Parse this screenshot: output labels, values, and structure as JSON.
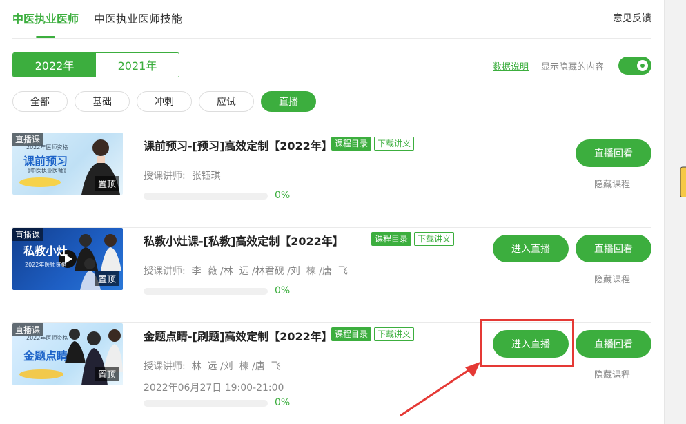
{
  "top_tabs": [
    "中医执业医师",
    "中医执业医师技能"
  ],
  "feedback": "意见反馈",
  "years": [
    "2022年",
    "2021年"
  ],
  "data_note": "数据说明",
  "show_hidden": "显示隐藏的内容",
  "show_hidden_on": true,
  "filters": [
    "全部",
    "基础",
    "冲刺",
    "应试",
    "直播"
  ],
  "active_filter": "直播",
  "courses": [
    {
      "title": "课前预习-[预习]高效定制【2022年】",
      "thumb_tag": "直播课",
      "thumb_pin": "置顶",
      "thumb_title": "课前预习",
      "thumb_sub": "2022年医师资格",
      "thumb_small": "《中医执业医师》",
      "tag_catalog": "课程目录",
      "tag_download": "下载讲义",
      "teacher": "授课讲师:  张钰琪",
      "time": "",
      "progress": "0%",
      "progress_fraction": 0,
      "btn_live": "",
      "btn_replay": "直播回看",
      "hide": "隐藏课程"
    },
    {
      "title": "私教小灶课-[私教]高效定制【2022年】",
      "thumb_tag": "直播课",
      "thumb_pin": "置顶",
      "thumb_title": "私教小灶",
      "thumb_sub": "",
      "thumb_small": "2022年医师资格",
      "tag_catalog": "课程目录",
      "tag_download": "下载讲义",
      "teacher": "授课讲师:  李  薇 /林  远 /林君砚 /刘  楝 /唐  飞",
      "time": "",
      "progress": "0%",
      "progress_fraction": 0,
      "btn_live": "进入直播",
      "btn_replay": "直播回看",
      "hide": "隐藏课程"
    },
    {
      "title": "金题点睛-[刷题]高效定制【2022年】",
      "thumb_tag": "直播课",
      "thumb_pin": "置顶",
      "thumb_title": "金题点睛",
      "thumb_sub": "2022年医师资格",
      "thumb_small": "",
      "tag_catalog": "课程目录",
      "tag_download": "下载讲义",
      "teacher": "授课讲师:  林  远 /刘  楝 /唐  飞",
      "time": "2022年06月27日 19:00-21:00",
      "progress": "0%",
      "progress_fraction": 0,
      "btn_live": "进入直播",
      "btn_replay": "直播回看",
      "hide": "隐藏课程"
    }
  ],
  "colors": {
    "brand": "#3cae3e",
    "highlight": "#e53935"
  }
}
